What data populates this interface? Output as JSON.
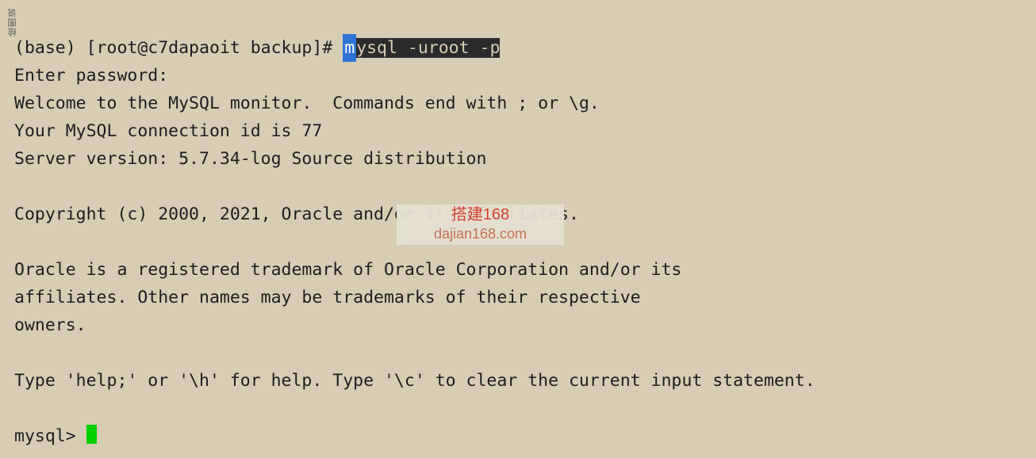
{
  "prompt_prefix": "(base) [root@c7dapaoit backup]# ",
  "command_first_char": "m",
  "command_rest": "ysql -uroot -p",
  "lines": [
    "Enter password: ",
    "Welcome to the MySQL monitor.  Commands end with ; or \\g.",
    "Your MySQL connection id is 77",
    "Server version: 5.7.34-log Source distribution",
    "",
    "Copyright (c) 2000, 2021, Oracle and/or its affiliates.",
    "",
    "Oracle is a registered trademark of Oracle Corporation and/or its",
    "affiliates. Other names may be trademarks of their respective",
    "owners.",
    "",
    "Type 'help;' or '\\h' for help. Type '\\c' to clear the current input statement.",
    ""
  ],
  "mysql_prompt": "mysql> ",
  "watermark": {
    "line1": "搭建168",
    "line2": "dajian168.com"
  },
  "sidebar_text": "绘图说"
}
